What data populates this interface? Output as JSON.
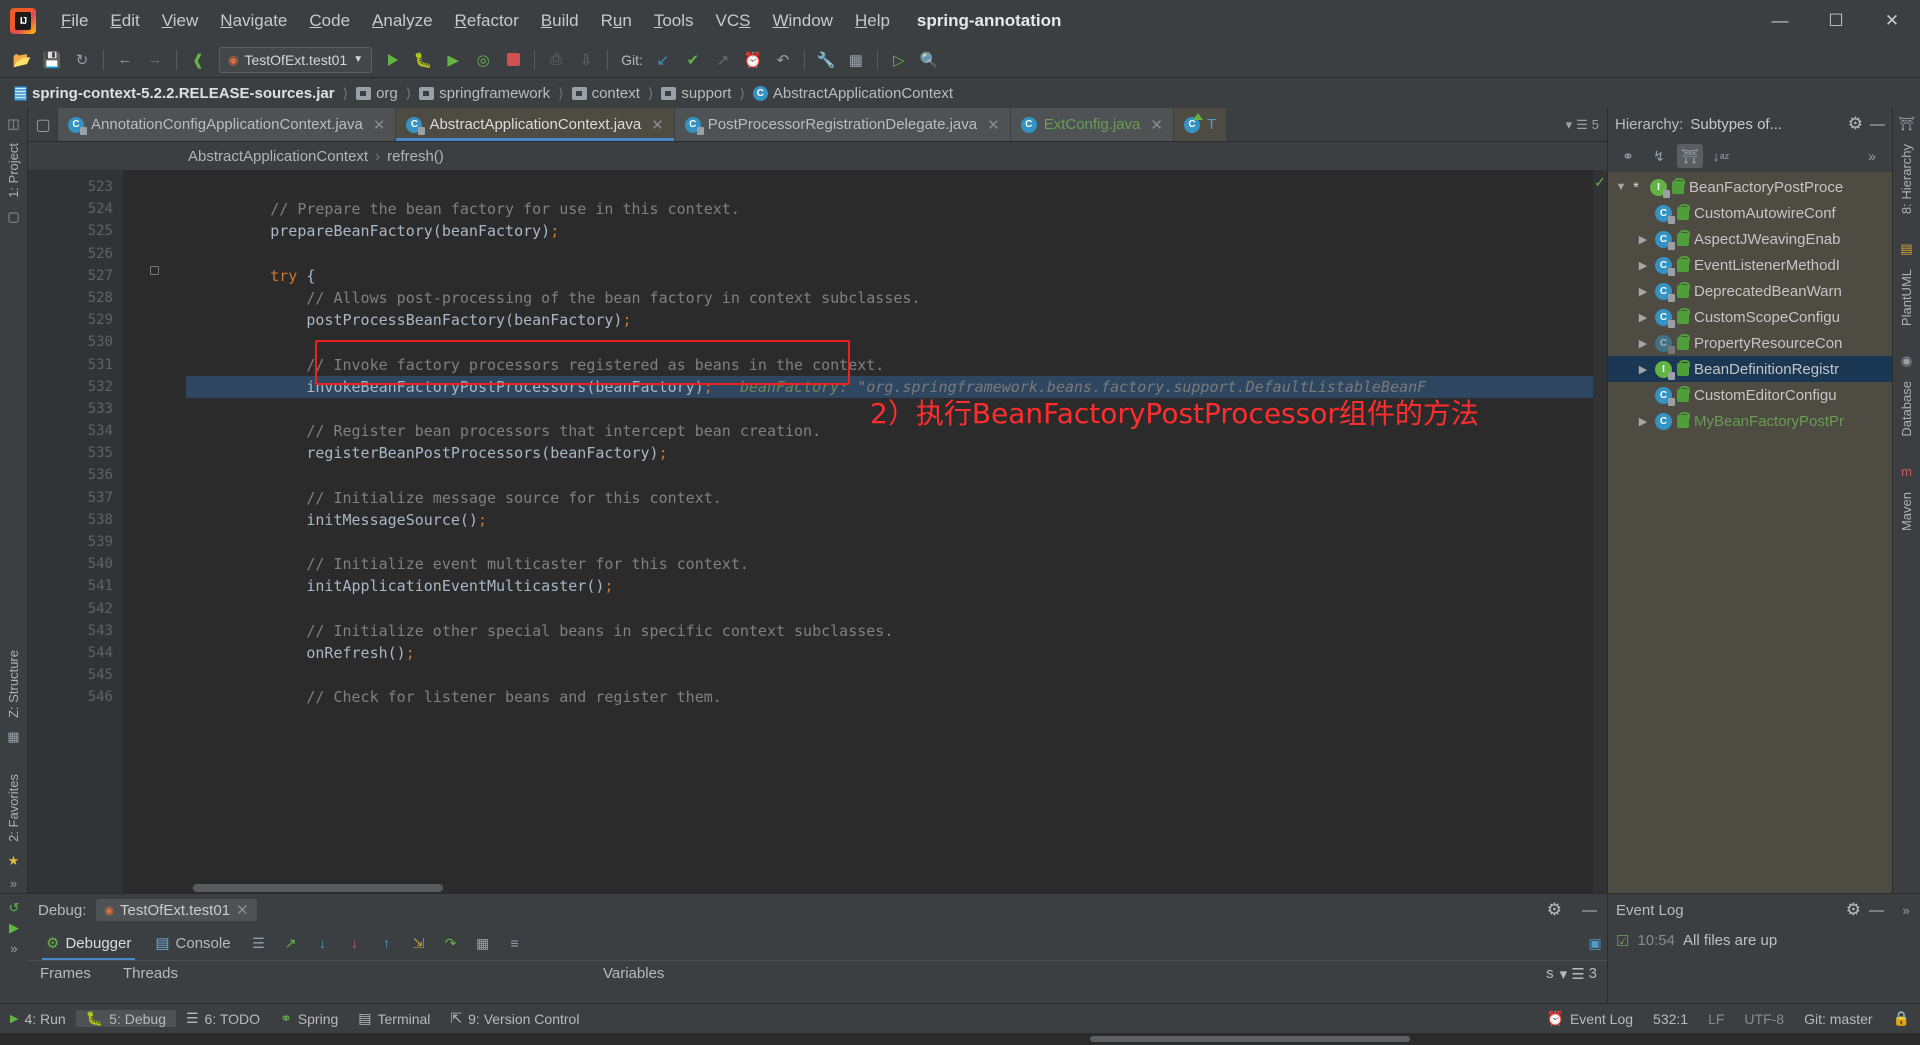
{
  "window": {
    "project_name": "spring-annotation",
    "minimize": "—",
    "maximize": "☐",
    "close": "✕"
  },
  "menu": [
    {
      "label": "File",
      "mnemonic": "F"
    },
    {
      "label": "Edit",
      "mnemonic": "E"
    },
    {
      "label": "View",
      "mnemonic": "V"
    },
    {
      "label": "Navigate",
      "mnemonic": "N"
    },
    {
      "label": "Code",
      "mnemonic": "C"
    },
    {
      "label": "Analyze",
      "mnemonic": "A"
    },
    {
      "label": "Refactor",
      "mnemonic": "R"
    },
    {
      "label": "Build",
      "mnemonic": "B"
    },
    {
      "label": "Run",
      "mnemonic": "u"
    },
    {
      "label": "Tools",
      "mnemonic": "T"
    },
    {
      "label": "VCS",
      "mnemonic": "S"
    },
    {
      "label": "Window",
      "mnemonic": "W"
    },
    {
      "label": "Help",
      "mnemonic": "H"
    }
  ],
  "toolbar": {
    "run_config": "TestOfExt.test01",
    "git_label": "Git:",
    "icons": [
      "open-folder-icon",
      "save-icon",
      "sync-icon",
      "back-arrow-icon",
      "forward-arrow-icon",
      "build-icon",
      "run-icon",
      "debug-icon",
      "run-with-coverage-icon",
      "profile-icon",
      "stop-icon",
      "update-project-icon",
      "commit-icon",
      "git-update-icon",
      "git-commit-icon",
      "git-push-icon",
      "history-icon",
      "rollback-icon",
      "settings-wrench-icon",
      "project-structure-icon",
      "run-anything-icon",
      "search-everywhere-icon"
    ]
  },
  "navbar": [
    {
      "label": "spring-context-5.2.2.RELEASE-sources.jar",
      "icon": "jar-icon"
    },
    {
      "label": "org",
      "icon": "folder-icon"
    },
    {
      "label": "springframework",
      "icon": "folder-icon"
    },
    {
      "label": "context",
      "icon": "folder-icon"
    },
    {
      "label": "support",
      "icon": "folder-icon"
    },
    {
      "label": "AbstractApplicationContext",
      "icon": "class-icon"
    }
  ],
  "left_rail": [
    {
      "label": "1: Project",
      "icon": "project-icon"
    },
    {
      "label": "Z: Structure",
      "icon": "structure-icon"
    },
    {
      "label": "2: Favorites",
      "icon": "favorites-icon"
    }
  ],
  "editor_tabs": [
    {
      "label": "AnnotationConfigApplicationContext.java",
      "active": false,
      "icon": "class-file-icon",
      "close": "✕"
    },
    {
      "label": "AbstractApplicationContext.java",
      "active": true,
      "icon": "class-file-icon",
      "close": "✕"
    },
    {
      "label": "PostProcessorRegistrationDelegate.java",
      "active": false,
      "icon": "class-file-icon",
      "close": "✕"
    },
    {
      "label": "ExtConfig.java",
      "active": false,
      "icon": "class-file-icon",
      "close": "✕",
      "green": true
    },
    {
      "label": "T",
      "active": false,
      "icon": "test-class-icon",
      "close": ""
    }
  ],
  "tabs_overflow": {
    "arrow": "▾",
    "count": "5"
  },
  "editor_breadcrumb": {
    "class": "AbstractApplicationContext",
    "sep": "›",
    "method": "refresh()"
  },
  "code": {
    "first_line": 523,
    "highlight_line": 532,
    "lines": [
      {
        "n": 523,
        "segments": []
      },
      {
        "n": 524,
        "segments": [
          {
            "t": "        // Prepare the bean factory for use in this context.",
            "c": "cmt"
          }
        ]
      },
      {
        "n": 525,
        "segments": [
          {
            "t": "        prepareBeanFactory(beanFactory)",
            "c": "mth"
          },
          {
            "t": ";",
            "c": "semi"
          }
        ]
      },
      {
        "n": 526,
        "segments": []
      },
      {
        "n": 527,
        "segments": [
          {
            "t": "        try",
            "c": "kw"
          },
          {
            "t": " {",
            "c": "mth"
          }
        ]
      },
      {
        "n": 528,
        "segments": [
          {
            "t": "            // Allows post-processing of the bean factory in context subclasses.",
            "c": "cmt"
          }
        ]
      },
      {
        "n": 529,
        "segments": [
          {
            "t": "            postProcessBeanFactory(beanFactory)",
            "c": "mth"
          },
          {
            "t": ";",
            "c": "semi"
          }
        ]
      },
      {
        "n": 530,
        "segments": []
      },
      {
        "n": 531,
        "segments": [
          {
            "t": "            // Invoke factory processors registered as beans in the context.",
            "c": "cmt"
          }
        ]
      },
      {
        "n": 532,
        "segments": [
          {
            "t": "            invokeBeanFactoryPostProcessors(beanFactory)",
            "c": "mth"
          },
          {
            "t": ";",
            "c": "semi"
          },
          {
            "t": "   beanFactory:",
            "c": "hint"
          },
          {
            "t": " \"org.springframework.beans.factory.support.DefaultListableBeanF",
            "c": "hint2"
          }
        ]
      },
      {
        "n": 533,
        "segments": []
      },
      {
        "n": 534,
        "segments": [
          {
            "t": "            // Register bean processors that intercept bean creation.",
            "c": "cmt"
          }
        ]
      },
      {
        "n": 535,
        "segments": [
          {
            "t": "            registerBeanPostProcessors(beanFactory)",
            "c": "mth"
          },
          {
            "t": ";",
            "c": "semi"
          }
        ]
      },
      {
        "n": 536,
        "segments": []
      },
      {
        "n": 537,
        "segments": [
          {
            "t": "            // Initialize message source for this context.",
            "c": "cmt"
          }
        ]
      },
      {
        "n": 538,
        "segments": [
          {
            "t": "            initMessageSource()",
            "c": "mth"
          },
          {
            "t": ";",
            "c": "semi"
          }
        ]
      },
      {
        "n": 539,
        "segments": []
      },
      {
        "n": 540,
        "segments": [
          {
            "t": "            // Initialize event multicaster for this context.",
            "c": "cmt"
          }
        ]
      },
      {
        "n": 541,
        "segments": [
          {
            "t": "            initApplicationEventMulticaster()",
            "c": "mth"
          },
          {
            "t": ";",
            "c": "semi"
          }
        ]
      },
      {
        "n": 542,
        "segments": []
      },
      {
        "n": 543,
        "segments": [
          {
            "t": "            // Initialize other special beans in specific context subclasses.",
            "c": "cmt"
          }
        ]
      },
      {
        "n": 544,
        "segments": [
          {
            "t": "            onRefresh()",
            "c": "mth"
          },
          {
            "t": ";",
            "c": "semi"
          }
        ]
      },
      {
        "n": 545,
        "segments": []
      },
      {
        "n": 546,
        "segments": [
          {
            "t": "            // Check for listener beans and register them.",
            "c": "cmt"
          }
        ]
      }
    ]
  },
  "annotation": {
    "text": "2）执行BeanFactoryPostProcessor组件的方法",
    "color": "#ff2d2d"
  },
  "hierarchy": {
    "title": "Hierarchy:",
    "subtitle": "Subtypes of...",
    "gear": "⚙",
    "minimize": "—",
    "toolbar_icons": [
      "supertypes-hierarchy-icon",
      "subtypes-hierarchy-icon",
      "class-hierarchy-icon",
      "sort-alphabetically-icon"
    ],
    "overflow": "»",
    "rail_label": "8: Hierarchy",
    "tree": [
      {
        "label": "BeanFactoryPostProce",
        "kind": "interface",
        "twisty": "▼",
        "star": "*",
        "indent": 0,
        "selected": false,
        "green": false
      },
      {
        "label": "CustomAutowireConf",
        "kind": "class",
        "twisty": "",
        "indent": 1,
        "selected": false,
        "green": false
      },
      {
        "label": "AspectJWeavingEnab",
        "kind": "class",
        "twisty": "▶",
        "indent": 1,
        "selected": false,
        "green": false
      },
      {
        "label": "EventListenerMethodI",
        "kind": "class",
        "twisty": "▶",
        "indent": 1,
        "selected": false,
        "green": false
      },
      {
        "label": "DeprecatedBeanWarn",
        "kind": "class",
        "twisty": "▶",
        "indent": 1,
        "selected": false,
        "green": false
      },
      {
        "label": "CustomScopeConfigu",
        "kind": "class",
        "twisty": "▶",
        "indent": 1,
        "selected": false,
        "green": false
      },
      {
        "label": "PropertyResourceCon",
        "kind": "class-dim",
        "twisty": "▶",
        "indent": 1,
        "selected": false,
        "green": false
      },
      {
        "label": "BeanDefinitionRegistr",
        "kind": "interface",
        "twisty": "▶",
        "indent": 1,
        "selected": true,
        "green": false
      },
      {
        "label": "CustomEditorConfigu",
        "kind": "class",
        "twisty": "",
        "indent": 1,
        "selected": false,
        "green": false
      },
      {
        "label": "MyBeanFactoryPostPr",
        "kind": "class-plain",
        "twisty": "▶",
        "indent": 1,
        "selected": false,
        "green": true
      }
    ]
  },
  "right_rail": [
    {
      "label": "8: Hierarchy",
      "icon": "hierarchy-icon"
    },
    {
      "label": "PlantUML",
      "icon": "plantuml-icon"
    },
    {
      "label": "Database",
      "icon": "database-icon"
    },
    {
      "label": "Maven",
      "icon": "maven-icon"
    }
  ],
  "debug": {
    "title": "Debug:",
    "session": "TestOfExt.test01",
    "close": "✕",
    "gear": "⚙",
    "minimize": "—",
    "tabs": [
      {
        "label": "Debugger",
        "active": true,
        "icon": "debugger-icon"
      },
      {
        "label": "Console",
        "active": false,
        "icon": "console-icon"
      }
    ],
    "toolbar_icons": [
      "mute-breakpoints-icon",
      "layout-icon",
      "step-over-icon",
      "step-into-icon",
      "force-step-into-icon",
      "step-out-icon",
      "drop-frame-icon",
      "run-to-cursor-icon",
      "evaluate-expression-icon",
      "settings-icon"
    ],
    "columns": {
      "frames": "Frames",
      "threads": "Threads",
      "variables": "Variables"
    },
    "var_overflow": {
      "s": "s",
      "arrow": "▾",
      "count": "3"
    },
    "rail_overflow": "»"
  },
  "event_log": {
    "title": "Event Log",
    "gear": "⚙",
    "minimize": "—",
    "time": "10:54",
    "message": "All files are up",
    "overflow": "»"
  },
  "statusbar": {
    "items": [
      {
        "label": "4: Run",
        "icon": "run-icon",
        "mnemonic": "4",
        "active": false
      },
      {
        "label": "5: Debug",
        "icon": "debug-icon",
        "mnemonic": "5",
        "active": true
      },
      {
        "label": "6: TODO",
        "icon": "todo-icon",
        "mnemonic": "6",
        "active": false
      },
      {
        "label": "Spring",
        "icon": "spring-icon",
        "mnemonic": "",
        "active": false
      },
      {
        "label": "Terminal",
        "icon": "terminal-icon",
        "mnemonic": "",
        "active": false
      },
      {
        "label": "9: Version Control",
        "icon": "version-control-icon",
        "mnemonic": "9",
        "active": false
      }
    ],
    "event_log_button": "Event Log",
    "caret": "532:1",
    "line_separator": "LF",
    "encoding": "UTF-8",
    "branch": "Git: master",
    "lock_icon": "read-only-icon"
  },
  "colors": {
    "accent": "#4a88c7",
    "annotation_red": "#ff2d2d",
    "green": "#62b543",
    "tab_active_bg": "#4e4b42",
    "editor_bg": "#2b2b2b",
    "panel_bg": "#3c3f41"
  }
}
